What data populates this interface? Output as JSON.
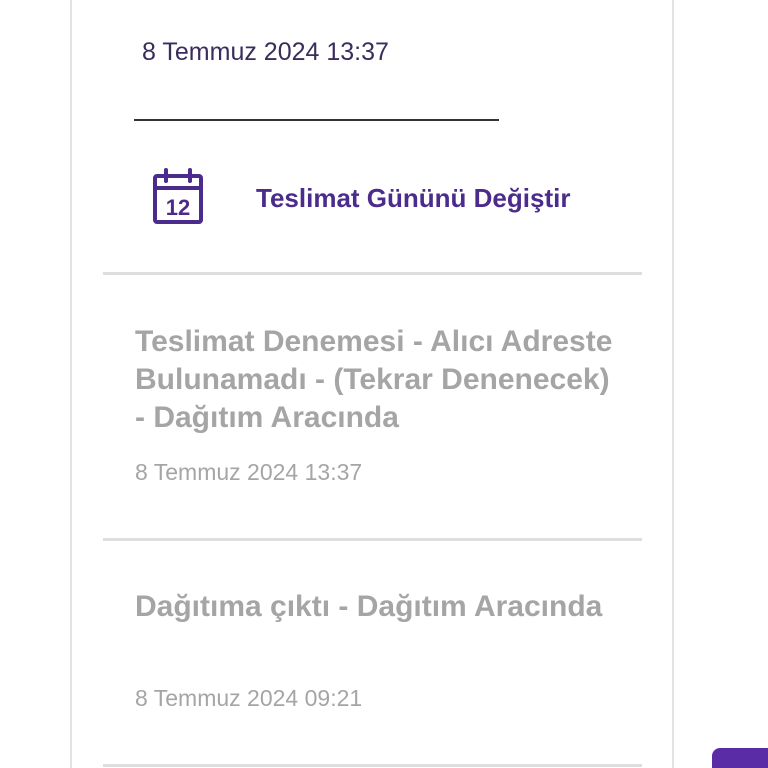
{
  "current_status": {
    "date": "8 Temmuz 2024 13:37"
  },
  "change_delivery": {
    "icon": "calendar-icon",
    "icon_day": "12",
    "label": "Teslimat Gününü Değiştir",
    "accent_color": "#4b2c8c"
  },
  "timeline": [
    {
      "title": "Teslimat Denemesi - Alıcı Adreste Bulunamadı - (Tekrar Denenecek) - Dağıtım Aracında",
      "date": "8 Temmuz 2024 13:37"
    },
    {
      "title": "Dağıtıma çıktı - Dağıtım Aracında",
      "date": "8 Temmuz 2024 09:21"
    }
  ],
  "colors": {
    "muted_text": "#a5a5a5",
    "primary": "#5a2da6"
  }
}
